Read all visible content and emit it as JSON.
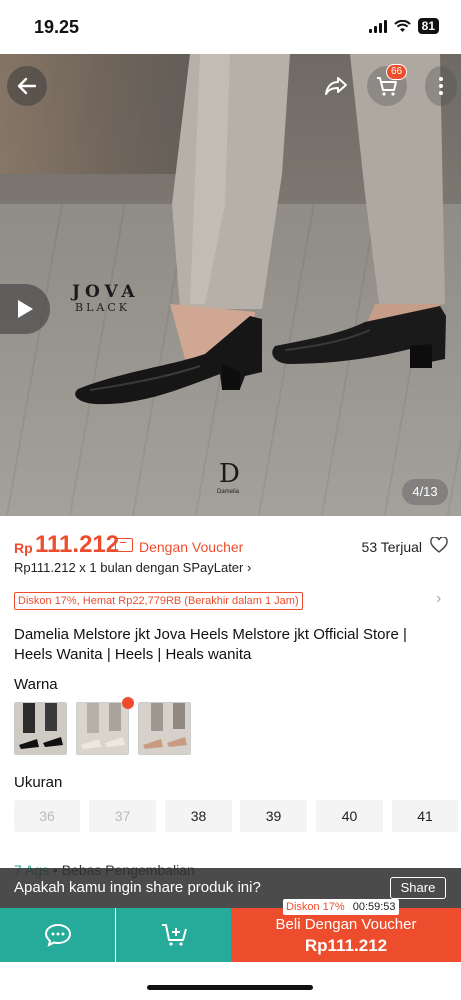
{
  "status_bar": {
    "time": "19.25",
    "battery": "81"
  },
  "product_image": {
    "overlay_title": "JOVA",
    "overlay_subtitle": "BLACK",
    "brand_letter": "D",
    "brand_name": "Damelia",
    "counter": "4/13",
    "cart_count": "66"
  },
  "icons": {
    "back": "arrow-left-icon",
    "share": "share-arrow-icon",
    "cart": "cart-icon",
    "more": "more-vertical-icon",
    "play": "play-icon",
    "heart": "heart-outline-icon",
    "voucher": "voucher-icon",
    "chat": "chat-icon",
    "add_cart": "cart-plus-icon"
  },
  "price": {
    "currency": "Rp",
    "value": "111.212",
    "voucher_label": "Dengan Voucher",
    "sold": "53 Terjual",
    "paylater": "Rp111.212 x 1 bulan dengan SPayLater ›",
    "discount_tag": "Diskon 17%, Hemat Rp22,779RB (Berakhir dalam 1 Jam)"
  },
  "product": {
    "title": "Damelia Melstore jkt Jova Heels Melstore jkt Official Store | Heels Wanita | Heels | Heals wanita"
  },
  "variants": {
    "color_label": "Warna",
    "size_label": "Ukuran",
    "sizes": [
      "36",
      "37",
      "38",
      "39",
      "40",
      "41"
    ]
  },
  "shipping": {
    "days": "7 Ags",
    "return": "• Bebas Pengembalian"
  },
  "share_banner": {
    "question": "Apakah kamu ingin share produk ini?",
    "button": "Share"
  },
  "bottom_bar": {
    "buy_label": "Beli Dengan Voucher",
    "buy_price": "Rp111.212",
    "discount": "Diskon 17%",
    "timer": "00:59:53"
  },
  "colors": {
    "accent": "#ee4d2d",
    "teal": "#26aa99"
  }
}
